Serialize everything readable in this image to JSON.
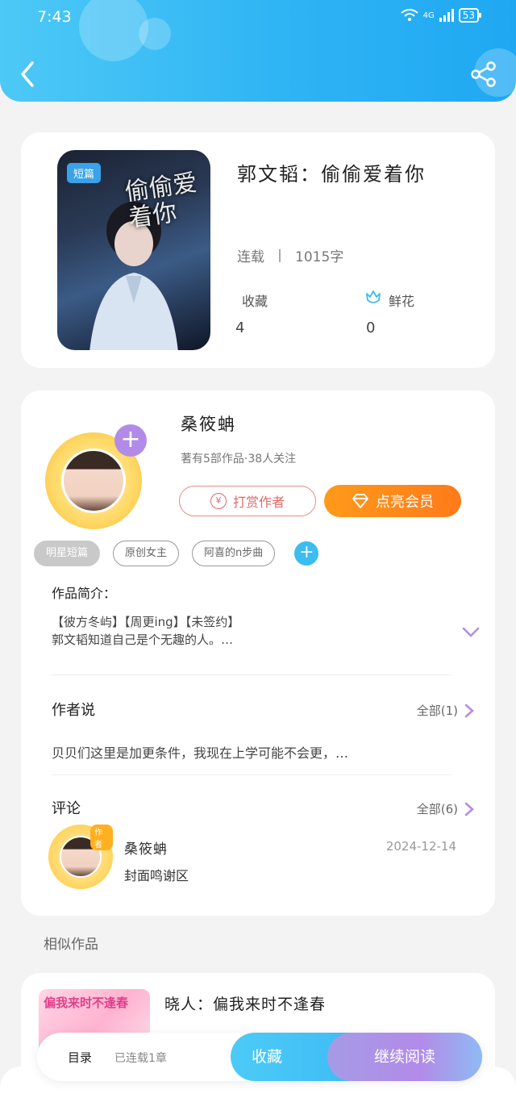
{
  "status_bar": {
    "time": "7:43",
    "network": "4G",
    "battery": "53"
  },
  "book": {
    "cover_tag": "短篇",
    "cover_title": "偷偷爱着你",
    "title": "郭文韬：偷偷爱着你",
    "status": "连载",
    "word_count": "1015字",
    "favorites_label": "收藏",
    "favorites_value": "4",
    "flowers_label": "鲜花",
    "flowers_value": "0"
  },
  "author": {
    "name": "桑筱蚺",
    "meta": "著有5部作品·38人关注",
    "tip_label": "打赏作者",
    "vip_label": "点亮会员"
  },
  "tags": [
    "明星短篇",
    "原创女主",
    "阿喜的n步曲"
  ],
  "intro": {
    "title": "作品简介：",
    "line1": "【彼方冬屿】【周更ing】【未签约】",
    "line2": "郭文韬知道自己是个无趣的人。…"
  },
  "author_say": {
    "title": "作者说",
    "see_all": "全部(1)",
    "text": "贝贝们这里是加更条件，我现在上学可能不会更，…"
  },
  "comments": {
    "title": "评论",
    "see_all": "全部(6)",
    "items": [
      {
        "badge": "作者",
        "user": "桑筱蚺",
        "date": "2024-12-14",
        "text": "封面鸣谢区"
      }
    ]
  },
  "similar": {
    "title": "相似作品",
    "items": [
      {
        "cover_text": "偏我来时不逢春",
        "name": "晓人：偏我来时不逢春"
      }
    ]
  },
  "bottom_bar": {
    "toc": "目录",
    "chapters": "已连载1章",
    "favorite": "收藏",
    "continue": "继续阅读"
  },
  "colors": {
    "header": "#2fb4f4",
    "accent_blue": "#3bbcf2",
    "vip_orange": "#ff8a1a",
    "purple": "#b28be8"
  }
}
